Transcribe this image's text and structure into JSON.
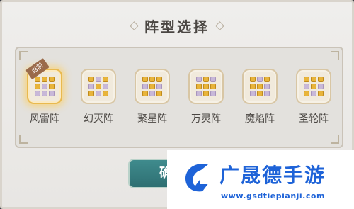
{
  "dialog": {
    "title": "阵型选择",
    "current_badge": "当前",
    "confirm_label": "确"
  },
  "formations": [
    {
      "name": "风雷阵",
      "selected": true,
      "pattern": [
        "g",
        "g",
        "g",
        "g",
        "p",
        "g",
        "p",
        "p",
        "p"
      ]
    },
    {
      "name": "幻灭阵",
      "selected": false,
      "pattern": [
        "g",
        "p",
        "g",
        "p",
        "g",
        "p",
        "g",
        "p",
        "g"
      ]
    },
    {
      "name": "聚星阵",
      "selected": false,
      "pattern": [
        "g",
        "g",
        "g",
        "p",
        "g",
        "p",
        "g",
        "p",
        "g"
      ]
    },
    {
      "name": "万灵阵",
      "selected": false,
      "pattern": [
        "p",
        "g",
        "p",
        "g",
        "g",
        "g",
        "p",
        "g",
        "p"
      ]
    },
    {
      "name": "魔焰阵",
      "selected": false,
      "pattern": [
        "g",
        "p",
        "g",
        "g",
        "g",
        "p",
        "p",
        "g",
        "p"
      ]
    },
    {
      "name": "圣轮阵",
      "selected": false,
      "pattern": [
        "g",
        "g",
        "g",
        "p",
        "g",
        "p",
        "g",
        "p",
        "g"
      ]
    }
  ],
  "watermark": {
    "title": "广晟德手游",
    "url": "www.gsdtiepianji.com"
  },
  "colors": {
    "gold_dot": "#e8b43a",
    "purple_dot": "#c8b8d8",
    "confirm_teal": "#2e6f72",
    "brand_blue": "#1e63d8"
  }
}
